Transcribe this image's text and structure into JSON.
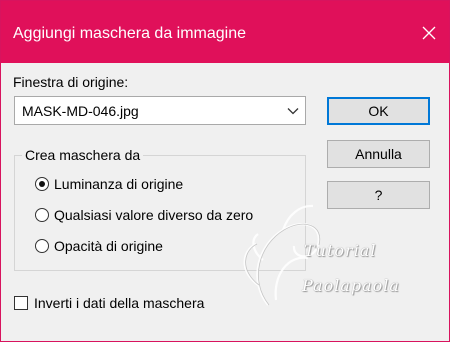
{
  "window": {
    "title": "Aggiungi maschera da immagine",
    "accent_color": "#e0105a",
    "close_icon": "close-icon"
  },
  "source": {
    "label": "Finestra di origine:",
    "selected": "MASK-MD-046.jpg"
  },
  "buttons": {
    "ok": "OK",
    "cancel": "Annulla",
    "help": "?"
  },
  "mask_group": {
    "title": "Crea maschera da",
    "options": [
      {
        "label": "Luminanza di origine",
        "checked": true
      },
      {
        "label": "Qualsiasi valore diverso da zero",
        "checked": false
      },
      {
        "label": "Opacità di origine",
        "checked": false
      }
    ]
  },
  "invert": {
    "label": "Inverti i dati della maschera",
    "checked": false
  },
  "watermark": {
    "line1": "Tutorial",
    "line2": "Paolapaola"
  }
}
